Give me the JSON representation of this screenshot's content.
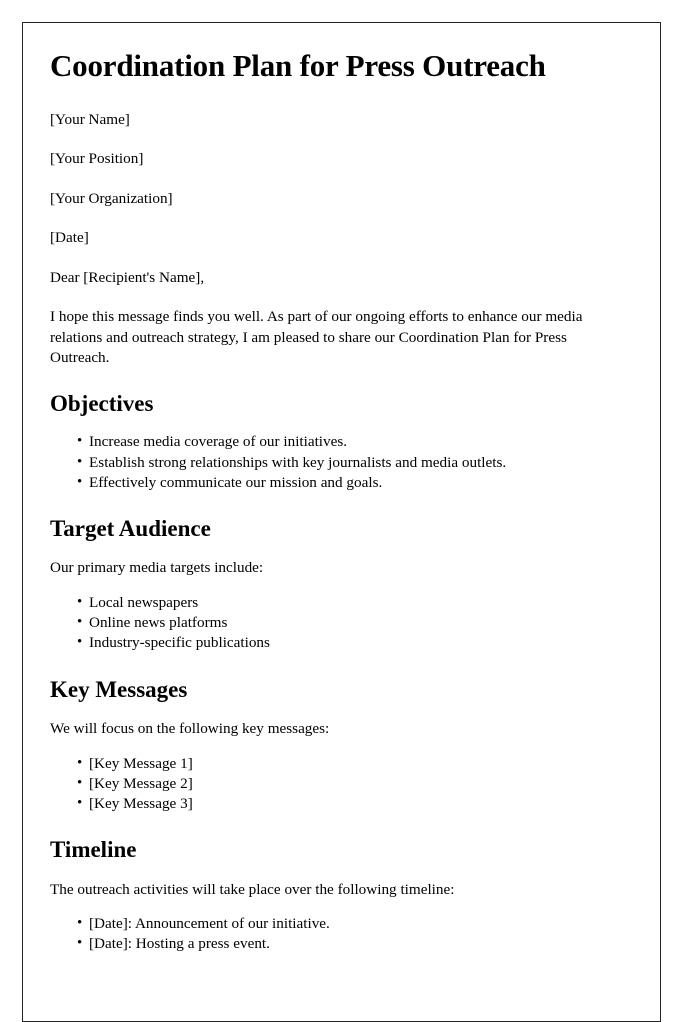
{
  "document": {
    "title": "Coordination Plan for Press Outreach",
    "header_fields": [
      "[Your Name]",
      "[Your Position]",
      "[Your Organization]",
      "[Date]"
    ],
    "salutation": "Dear [Recipient's Name],",
    "intro_paragraph": "I hope this message finds you well. As part of our ongoing efforts to enhance our media relations and outreach strategy, I am pleased to share our Coordination Plan for Press Outreach.",
    "sections": [
      {
        "heading": "Objectives",
        "intro": "",
        "items": [
          "Increase media coverage of our initiatives.",
          "Establish strong relationships with key journalists and media outlets.",
          "Effectively communicate our mission and goals."
        ]
      },
      {
        "heading": "Target Audience",
        "intro": "Our primary media targets include:",
        "items": [
          "Local newspapers",
          "Online news platforms",
          "Industry-specific publications"
        ]
      },
      {
        "heading": "Key Messages",
        "intro": "We will focus on the following key messages:",
        "items": [
          "[Key Message 1]",
          "[Key Message 2]",
          "[Key Message 3]"
        ]
      },
      {
        "heading": "Timeline",
        "intro": "The outreach activities will take place over the following timeline:",
        "items": [
          "[Date]: Announcement of our initiative.",
          "[Date]: Hosting a press event."
        ]
      }
    ]
  }
}
